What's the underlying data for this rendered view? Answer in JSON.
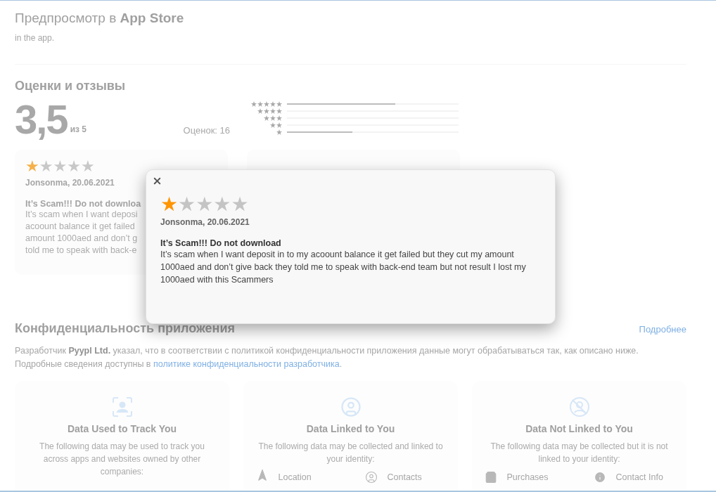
{
  "header": {
    "title": "Предпросмотр в **App Store**",
    "subtitle": "in the app."
  },
  "ratings": {
    "heading": "Оценки и отзывы",
    "score": "3,5",
    "out_of": "из 5",
    "count": "Оценок: 16",
    "histogram": [
      {
        "kind": "five",
        "level": 0.63
      },
      {
        "kind": "four"
      },
      {
        "kind": "three"
      },
      {
        "kind": "two"
      },
      {
        "kind": "one",
        "level": 0.38
      }
    ],
    "reviews": [
      {
        "stars": 1,
        "author": "Jonsonma, 20.06.2021",
        "title": "It’s Scam!!! Do not downloa",
        "lines": [
          "It’s scam when I want deposi",
          "acoount balance it get failed",
          "amount 1000aed and don’t g",
          "told me to speak with back-e"
        ]
      }
    ]
  },
  "dialog": {
    "stars": 1,
    "author": "Jonsonma, 20.06.2021",
    "title": "It’s Scam!!! Do not download",
    "body": "It’s scam when I want deposit in to my acoount balance it get failed but they cut my amount 1000aed and don’t give back they told me to speak with back-end team but not result I lost my 1000aed with this Scammers"
  },
  "privacy": {
    "heading": "Конфиденциальность приложения",
    "more_link": "Подробнее",
    "text": "Разработчик **Pyypl Ltd.** указал, что в соответствии с политикой конфиденциальности приложения данные могут обрабатываться так, как описано ниже.",
    "text2": "Подробные сведения доступны в",
    "policy_link": "политике конфиденциальности разработчика",
    "text2_end": ".",
    "cards": [
      {
        "kind": "track",
        "title": "Data Used to Track You",
        "description": "The following data may be used to track you across apps and websites owned by other companies:"
      },
      {
        "kind": "linked",
        "title": "Data Linked to You",
        "description": "The following data may be collected and linked to your identity:",
        "items": [
          {
            "kind": "location",
            "label": "Location"
          },
          {
            "kind": "contacts",
            "label": "Contacts"
          }
        ]
      },
      {
        "kind": "not_linked",
        "title": "Data Not Linked to You",
        "description": "The following data may be collected but it is not linked to your identity:",
        "items": [
          {
            "kind": "purchases",
            "label": "Purchases"
          },
          {
            "kind": "info",
            "label": "Contact Info"
          }
        ]
      }
    ]
  }
}
